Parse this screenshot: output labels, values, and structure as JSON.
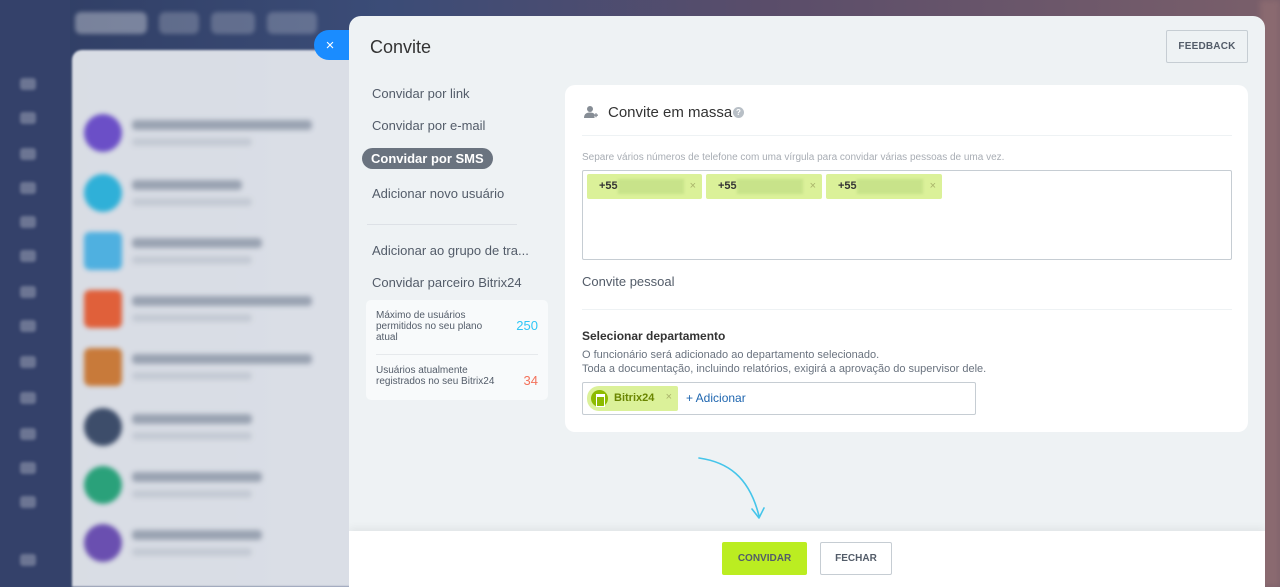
{
  "dialog": {
    "title": "Convite",
    "feedback_label": "FEEDBACK",
    "close_symbol": "×"
  },
  "menu": {
    "items": [
      {
        "label": "Convidar por link"
      },
      {
        "label": "Convidar por e-mail"
      },
      {
        "label": "Convidar por SMS",
        "active": true
      },
      {
        "label": "Adicionar novo usuário"
      }
    ],
    "secondary": [
      {
        "label": "Adicionar ao grupo de tra..."
      },
      {
        "label": "Convidar parceiro Bitrix24"
      }
    ]
  },
  "stats": {
    "max_label": "Máximo de usuários permitidos no seu plano atual",
    "max_value": "250",
    "current_label": "Usuários atualmente registrados no seu Bitrix24",
    "current_value": "34"
  },
  "mass_invite": {
    "title": "Convite em massa",
    "help": "?",
    "hint": "Separe vários números de telefone com uma vírgula para convidar várias pessoas de uma vez.",
    "phones": [
      {
        "prefix": "+55"
      },
      {
        "prefix": "+55"
      },
      {
        "prefix": "+55"
      }
    ],
    "remove_symbol": "×",
    "personal_link": "Convite pessoal"
  },
  "department": {
    "title": "Selecionar departamento",
    "desc_line1": "O funcionário será adicionado ao departamento selecionado.",
    "desc_line2": "Toda a documentação, incluindo relatórios, exigirá a aprovação do supervisor dele.",
    "selected": "Bitrix24",
    "add_label": "+ Adicionar"
  },
  "footer": {
    "invite_label": "CONVIDAR",
    "close_label": "FECHAR"
  },
  "colors": {
    "accent": "#bbed21",
    "tag_bg": "#dbf199",
    "link": "#2067b0",
    "close_tab": "#1a8cff"
  }
}
